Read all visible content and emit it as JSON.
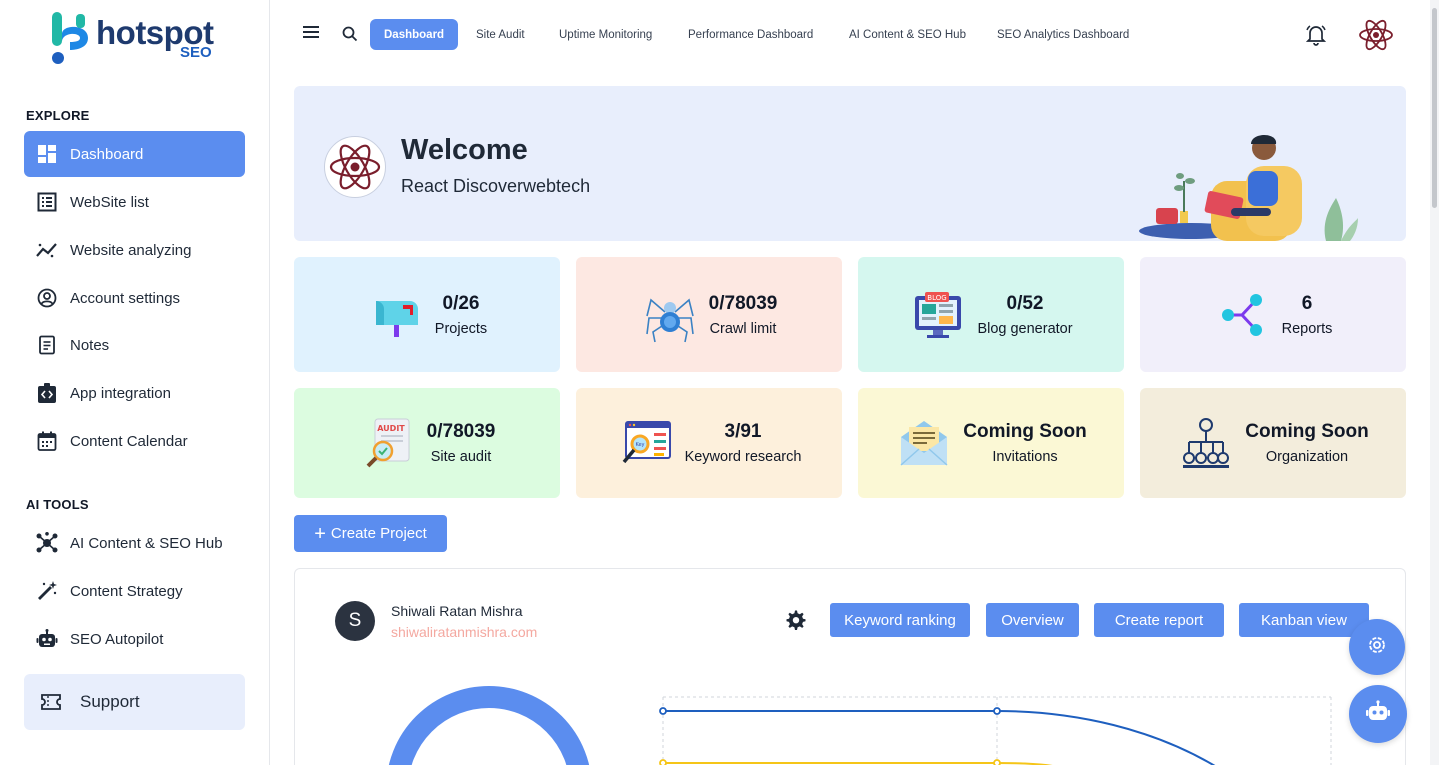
{
  "brand": {
    "name": "hotspot",
    "sub": "SEO"
  },
  "sidebar": {
    "explore_title": "EXPLORE",
    "items": [
      {
        "label": "Dashboard",
        "icon": "dashboard-icon",
        "active": true
      },
      {
        "label": "WebSite list",
        "icon": "list-icon"
      },
      {
        "label": "Website analyzing",
        "icon": "analytics-icon"
      },
      {
        "label": "Account settings",
        "icon": "account-icon"
      },
      {
        "label": "Notes",
        "icon": "notes-icon"
      },
      {
        "label": "App integration",
        "icon": "integration-icon"
      },
      {
        "label": "Content Calendar",
        "icon": "calendar-icon"
      }
    ],
    "ai_title": "AI TOOLS",
    "ai_items": [
      {
        "label": "AI Content & SEO Hub",
        "icon": "hub-icon"
      },
      {
        "label": "Content Strategy",
        "icon": "magic-wand-icon"
      },
      {
        "label": "SEO Autopilot",
        "icon": "robot-icon"
      }
    ],
    "support": "Support"
  },
  "topbar": {
    "tabs": [
      {
        "label": "Dashboard",
        "active": true
      },
      {
        "label": "Site Audit"
      },
      {
        "label": "Uptime Monitoring"
      },
      {
        "label": "Performance Dashboard"
      },
      {
        "label": "AI Content & SEO Hub"
      },
      {
        "label": "SEO Analytics Dashboard"
      }
    ]
  },
  "welcome": {
    "title": "Welcome",
    "subtitle": "React Discoverwebtech"
  },
  "stats": [
    {
      "value": "0/26",
      "label": "Projects",
      "bg": "#e0f2fe",
      "icon": "mailbox-icon"
    },
    {
      "value": "0/78039",
      "label": "Crawl limit",
      "bg": "#fde8e2",
      "icon": "spider-icon"
    },
    {
      "value": "0/52",
      "label": "Blog generator",
      "bg": "#d5f7ef",
      "icon": "blog-icon"
    },
    {
      "value": "6",
      "label": "Reports",
      "bg": "#f1effa",
      "icon": "share-nodes-icon"
    },
    {
      "value": "0/78039",
      "label": "Site audit",
      "bg": "#dcfce0",
      "icon": "audit-icon"
    },
    {
      "value": "3/91",
      "label": "Keyword research",
      "bg": "#fdf0dc",
      "icon": "keyword-icon"
    },
    {
      "value": "Coming Soon",
      "label": "Invitations",
      "bg": "#fbf8d5",
      "icon": "envelope-icon"
    },
    {
      "value": "Coming Soon",
      "label": "Organization",
      "bg": "#f3eddc",
      "icon": "org-chart-icon"
    }
  ],
  "create_project": "Create Project",
  "project": {
    "avatar_letter": "S",
    "name": "Shiwali Ratan Mishra",
    "domain": "shiwaliratanmishra.com",
    "buttons": [
      "Keyword ranking",
      "Overview",
      "Create report",
      "Kanban view"
    ]
  },
  "colors": {
    "accent": "#5b8def",
    "brand_dark": "#1e3a6e"
  }
}
